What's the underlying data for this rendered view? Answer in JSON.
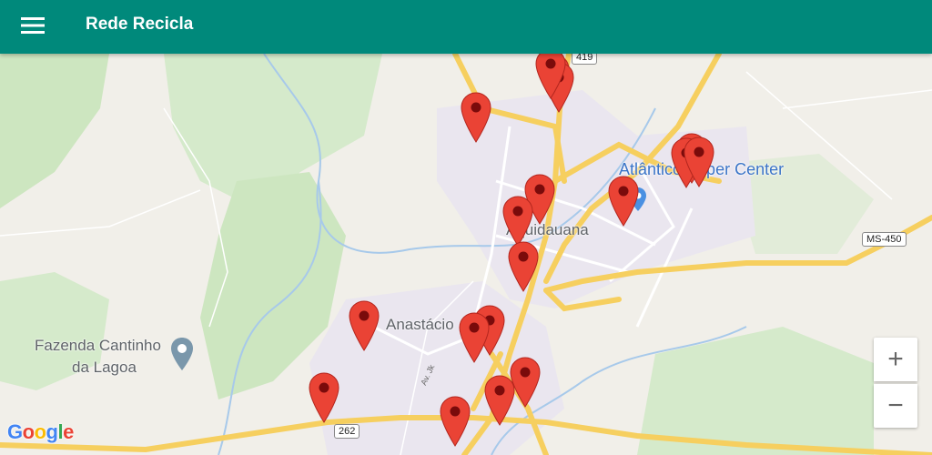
{
  "app": {
    "title": "Rede Recicla",
    "menu_icon": "hamburger-menu-icon"
  },
  "colors": {
    "appbar": "#00897b",
    "marker": "#ea4335",
    "marker_dot": "#7a0b0b",
    "road_major": "#fbd86b",
    "green_area": "#cde6c0"
  },
  "map": {
    "labels": {
      "city": "Aquidauana",
      "district": "Anastácio",
      "poi_line1": "Fazenda Cantinho",
      "poi_line2": "da Lagoa",
      "store": "Atlântico Super Center"
    },
    "road_shields": {
      "r419": "419",
      "ms450": "MS-450",
      "r262": "262",
      "avenue": "Av. Jk"
    },
    "markers_count": 18,
    "zoom_in_label": "+",
    "zoom_out_label": "−",
    "attribution": "Google"
  }
}
